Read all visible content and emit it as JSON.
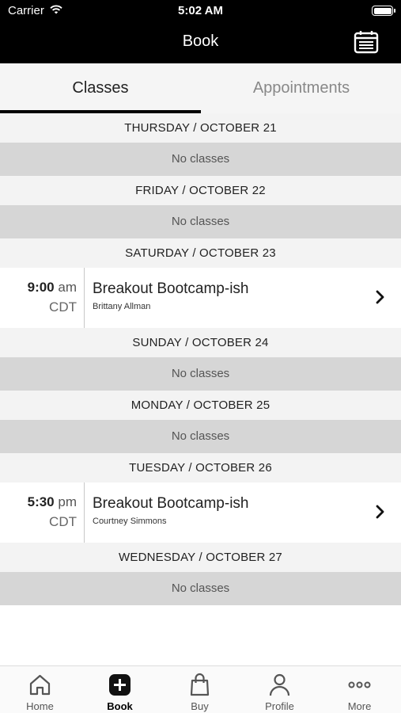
{
  "status_bar": {
    "carrier": "Carrier",
    "time": "5:02 AM"
  },
  "nav": {
    "title": "Book"
  },
  "tabs": {
    "classes": "Classes",
    "appointments": "Appointments"
  },
  "schedule": {
    "days": [
      {
        "header": "THURSDAY / OCTOBER 21",
        "empty": "No classes"
      },
      {
        "header": "FRIDAY / OCTOBER 22",
        "empty": "No classes"
      },
      {
        "header": "SATURDAY / OCTOBER 23",
        "class": {
          "time": "9:00",
          "ampm": "am",
          "tz": "CDT",
          "name": "Breakout Bootcamp-ish",
          "instructor": "Brittany Allman"
        }
      },
      {
        "header": "SUNDAY / OCTOBER 24",
        "empty": "No classes"
      },
      {
        "header": "MONDAY / OCTOBER 25",
        "empty": "No classes"
      },
      {
        "header": "TUESDAY / OCTOBER 26",
        "class": {
          "time": "5:30",
          "ampm": "pm",
          "tz": "CDT",
          "name": "Breakout Bootcamp-ish",
          "instructor": "Courtney Simmons"
        }
      },
      {
        "header": "WEDNESDAY / OCTOBER 27",
        "empty": "No classes"
      }
    ]
  },
  "tab_bar": {
    "home": "Home",
    "book": "Book",
    "buy": "Buy",
    "profile": "Profile",
    "more": "More"
  },
  "colors": {
    "bar": "#000000",
    "accent": "#000000",
    "empty_row": "#d6d6d6"
  }
}
